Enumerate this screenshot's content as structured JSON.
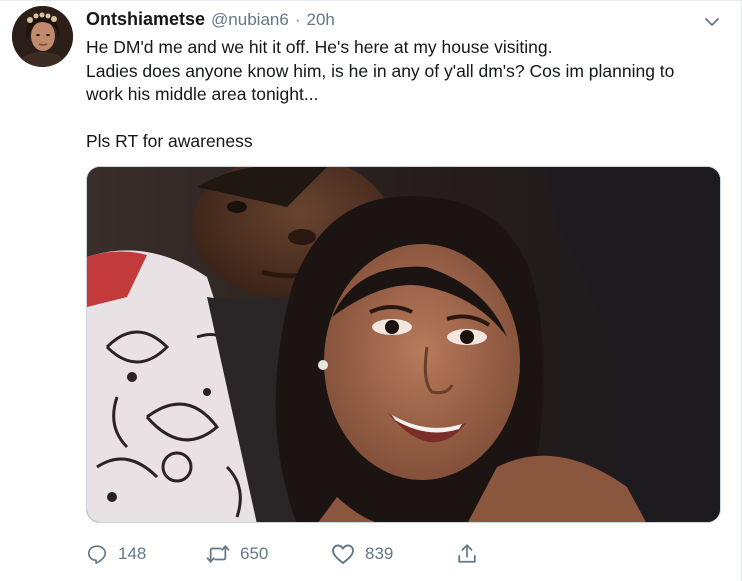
{
  "tweet": {
    "display_name": "Ontshiametse",
    "handle": "@nubian6",
    "separator": "·",
    "time": "20h",
    "text_lines": [
      "He DM'd me and we hit it off. He's here at my house visiting.",
      "Ladies does anyone know him, is he in any of y'all dm's? Cos im planning to",
      "work his middle area tonight...",
      "",
      "Pls RT for awareness"
    ],
    "media_description": "selfie-photo",
    "actions": {
      "reply_count": "148",
      "retweet_count": "650",
      "like_count": "839"
    }
  },
  "icons": {
    "menu": "chevron-down-icon",
    "reply": "reply-icon",
    "retweet": "retweet-icon",
    "like": "heart-icon",
    "share": "share-icon"
  },
  "colors": {
    "secondary_text": "#657786",
    "border": "#ccd6dd"
  }
}
